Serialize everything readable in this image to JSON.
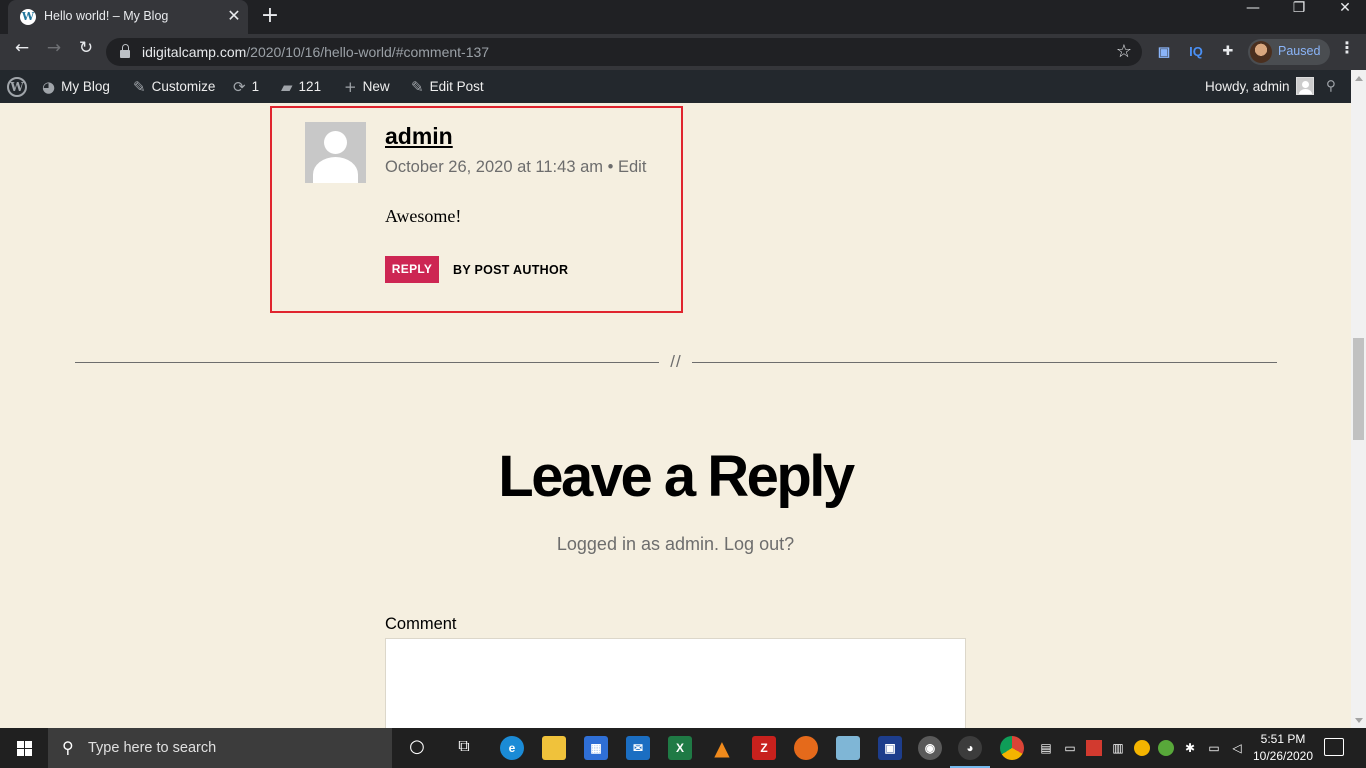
{
  "browser": {
    "tab_title": "Hello world! – My Blog",
    "url_host": "idigitalcamp.com",
    "url_path": "/2020/10/16/hello-world/#comment-137",
    "profile_status": "Paused",
    "extension_iq_label": "IQ"
  },
  "admin_bar": {
    "site_name": "My Blog",
    "customize": "Customize",
    "updates_count": "1",
    "comments_count": "121",
    "new_label": "New",
    "edit_post": "Edit Post",
    "howdy": "Howdy, admin"
  },
  "comment": {
    "author": "admin",
    "date": "October 26, 2020 at 11:43 am",
    "separator": " • ",
    "edit_label": "Edit",
    "text": "Awesome!",
    "reply_label": "REPLY",
    "badge": "BY POST AUTHOR"
  },
  "separator_mark": "//",
  "reply_form": {
    "title": "Leave a Reply",
    "logged_in_text": "Logged in as admin.",
    "logout_link": "Log out?",
    "comment_label": "Comment",
    "comment_value": ""
  },
  "taskbar": {
    "search_placeholder": "Type here to search",
    "time": "5:51 PM",
    "date": "10/26/2020"
  },
  "colors": {
    "page_background": "#f5efe0",
    "accent": "#cd2653",
    "highlight_border": "#e0242e",
    "admin_bar": "#23282d"
  }
}
